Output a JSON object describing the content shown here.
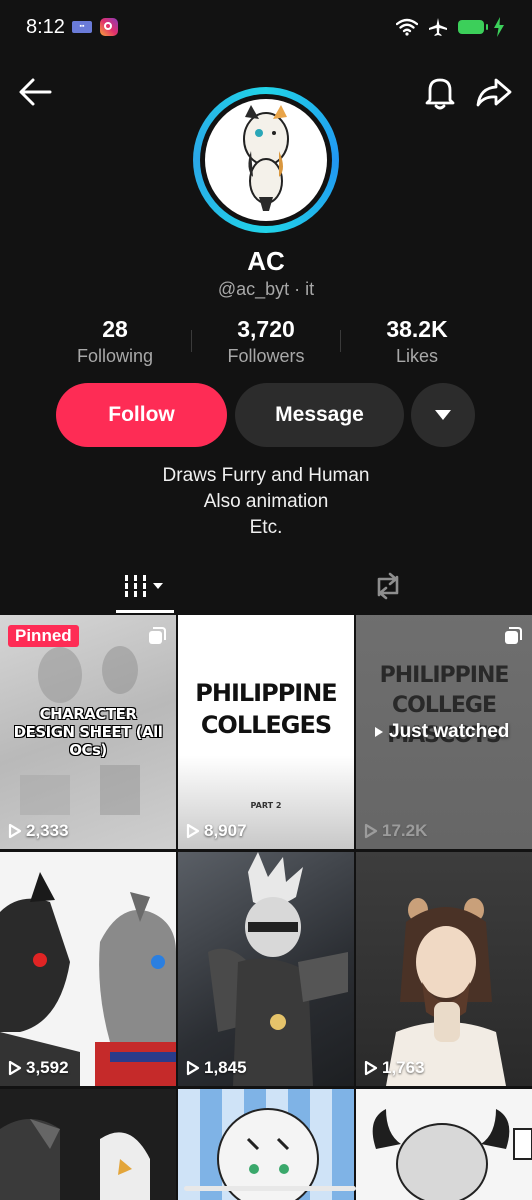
{
  "status": {
    "time": "8:12"
  },
  "profile": {
    "name": "AC",
    "handle": "@ac_byt · it",
    "stats": [
      {
        "value": "28",
        "label": "Following"
      },
      {
        "value": "3,720",
        "label": "Followers"
      },
      {
        "value": "38.2K",
        "label": "Likes"
      }
    ],
    "follow_label": "Follow",
    "message_label": "Message",
    "bio": [
      "Draws Furry and Human",
      "Also animation",
      "Etc."
    ]
  },
  "videos": [
    {
      "count": "2,333",
      "badge": "Pinned",
      "title": "CHARACTER DESIGN SHEET (All OCs)"
    },
    {
      "count": "8,907",
      "title_lines": [
        "PHILIPPINE",
        "COLLEGES"
      ],
      "subtitle": "PART 2"
    },
    {
      "count": "17.2K",
      "title_lines": [
        "PHILIPPINE",
        "COLLEGE",
        "MASCOTS"
      ],
      "overlay": "Just watched"
    },
    {
      "count": "3,592"
    },
    {
      "count": "1,845"
    },
    {
      "count": "1,763"
    }
  ],
  "colors": {
    "accent": "#fe2c55",
    "background": "#121212",
    "button_secondary": "#2c2c2c",
    "ring": "#21d4e8"
  }
}
